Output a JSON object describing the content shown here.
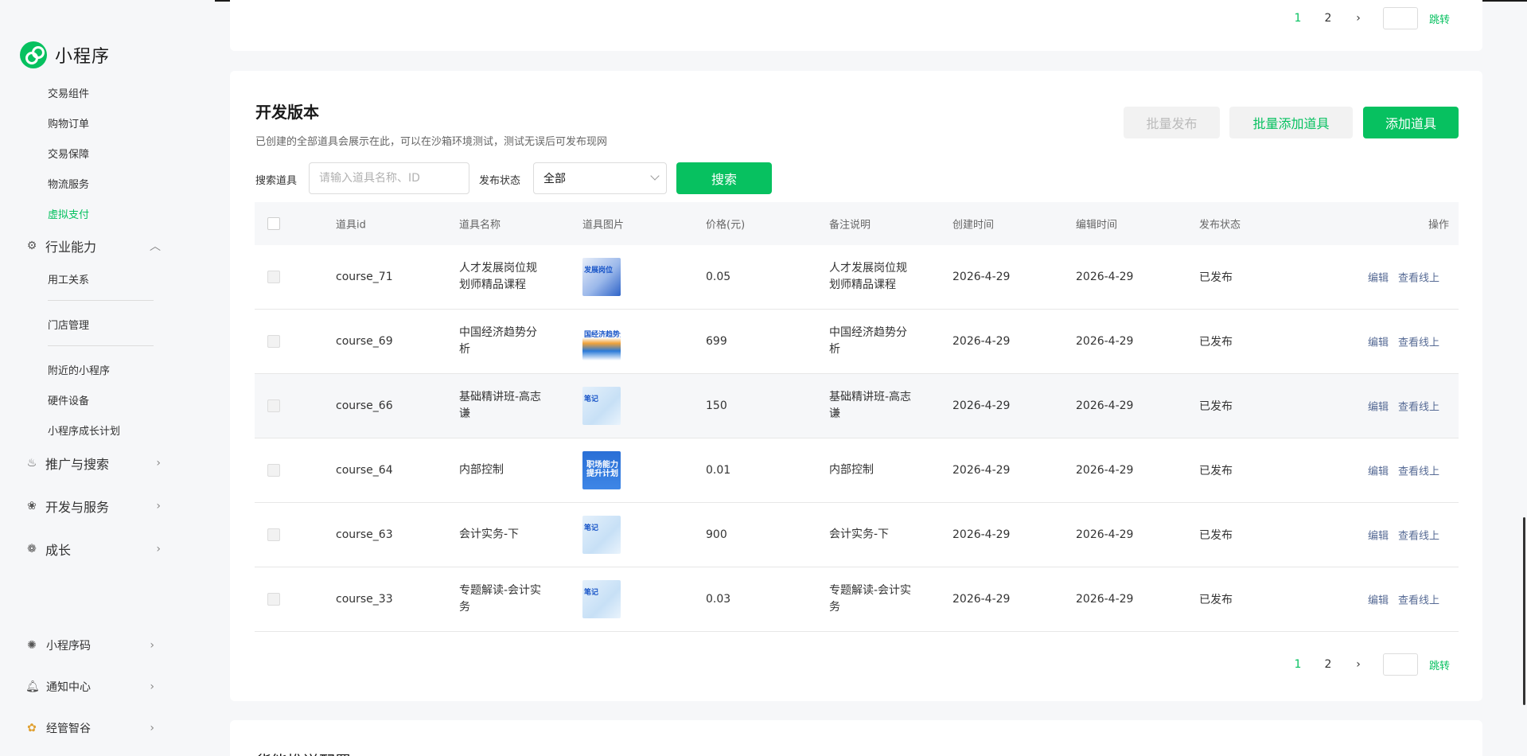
{
  "app": {
    "title": "小程序"
  },
  "sidebar": {
    "sub_items_top": [
      {
        "label": "交易组件"
      },
      {
        "label": "购物订单"
      },
      {
        "label": "交易保障"
      },
      {
        "label": "物流服务"
      },
      {
        "label": "虚拟支付",
        "active": true
      }
    ],
    "industry": {
      "label": "行业能力",
      "icon": "industry-icon",
      "expanded": true
    },
    "industry_items": [
      {
        "label": "用工关系"
      },
      {
        "label": "门店管理"
      },
      {
        "label": "附近的小程序"
      },
      {
        "label": "硬件设备"
      },
      {
        "label": "小程序成长计划"
      }
    ],
    "groups": [
      {
        "label": "推广与搜索",
        "icon": "flame-icon"
      },
      {
        "label": "开发与服务",
        "icon": "dev-service-icon"
      },
      {
        "label": "成长",
        "icon": "growth-icon"
      }
    ],
    "bottom": [
      {
        "label": "小程序码",
        "icon": "qrcode-icon"
      },
      {
        "label": "通知中心",
        "icon": "bell-icon"
      },
      {
        "label": "经管智谷",
        "icon": "brand-icon"
      }
    ]
  },
  "top_pager": {
    "pages": [
      "1",
      "2"
    ],
    "current": "1",
    "next": "›",
    "jump_label": "跳转"
  },
  "dev": {
    "title": "开发版本",
    "description": "已创建的全部道具会展示在此，可以在沙箱环境测试，测试无误后可发布现网",
    "buttons": {
      "batch_publish": "批量发布",
      "batch_add": "批量添加道具",
      "add": "添加道具"
    },
    "filter": {
      "search_label": "搜索道具",
      "search_placeholder": "请输入道具名称、ID",
      "status_label": "发布状态",
      "status_value": "全部",
      "search_button": "搜索"
    },
    "columns": [
      "道具id",
      "道具名称",
      "道具图片",
      "价格(元)",
      "备注说明",
      "创建时间",
      "编辑时间",
      "发布状态",
      "操作"
    ],
    "rows": [
      {
        "id": "course_71",
        "name": "人才发展岗位规划师精品课程",
        "thumb": "t1",
        "thumb_text": "发展岗位",
        "price": "0.05",
        "remark": "人才发展岗位规划师精品课程",
        "created": "2026-4-29",
        "edited": "2026-4-29",
        "status": "已发布"
      },
      {
        "id": "course_69",
        "name": "中国经济趋势分析",
        "thumb": "t2",
        "thumb_text": "国经济趋势分",
        "price": "699",
        "remark": "中国经济趋势分析",
        "created": "2026-4-29",
        "edited": "2026-4-29",
        "status": "已发布"
      },
      {
        "id": "course_66",
        "name": "基础精讲班-高志谦",
        "thumb": "t3",
        "thumb_text": "笔记",
        "price": "150",
        "remark": "基础精讲班-高志谦",
        "created": "2026-4-29",
        "edited": "2026-4-29",
        "status": "已发布"
      },
      {
        "id": "course_64",
        "name": "内部控制",
        "thumb": "t4",
        "thumb_text": "职场能力提升计划",
        "price": "0.01",
        "remark": "内部控制",
        "created": "2026-4-29",
        "edited": "2026-4-29",
        "status": "已发布"
      },
      {
        "id": "course_63",
        "name": "会计实务-下",
        "thumb": "t3",
        "thumb_text": "笔记",
        "price": "900",
        "remark": "会计实务-下",
        "created": "2026-4-29",
        "edited": "2026-4-29",
        "status": "已发布"
      },
      {
        "id": "course_33",
        "name": "专题解读-会计实务",
        "thumb": "t3",
        "thumb_text": "笔记",
        "price": "0.03",
        "remark": "专题解读-会计实务",
        "created": "2026-4-29",
        "edited": "2026-4-29",
        "status": "已发布"
      }
    ],
    "actions": {
      "edit": "编辑",
      "view_online": "查看线上"
    },
    "pager": {
      "pages": [
        "1",
        "2"
      ],
      "current": "1",
      "next": "›",
      "jump_label": "跳转"
    }
  },
  "next_section": {
    "title": "货能推送配置"
  },
  "colors": {
    "brand": "#07c160",
    "link": "#576b95"
  }
}
